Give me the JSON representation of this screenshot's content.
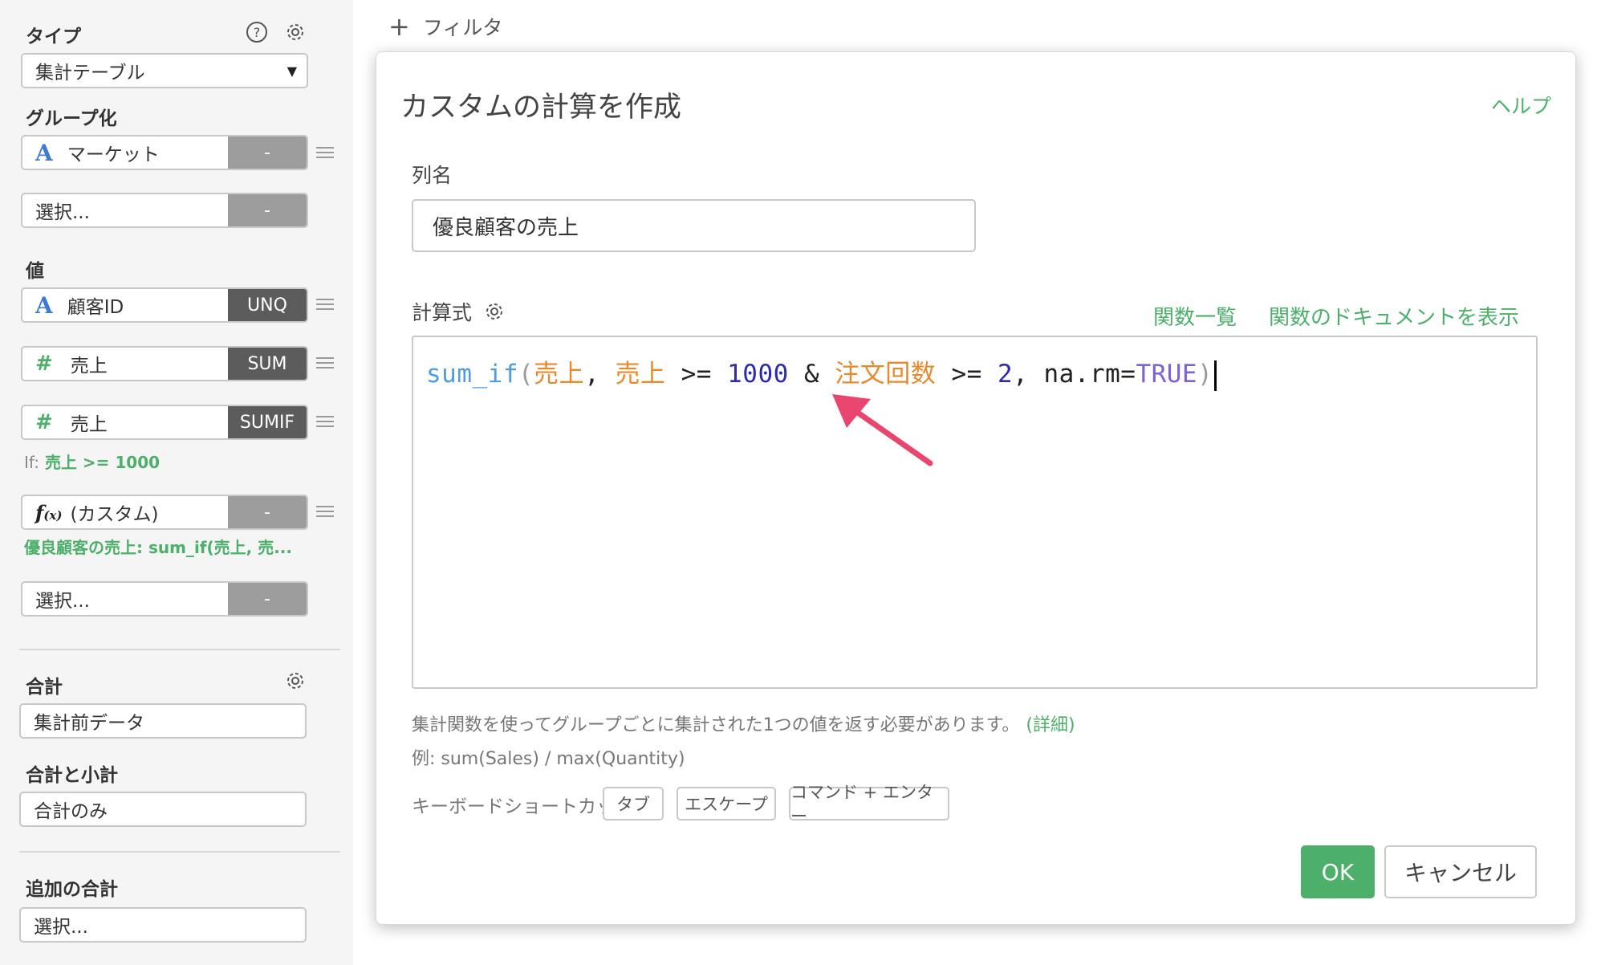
{
  "left": {
    "type_title": "タイプ",
    "type_value": "集計テーブル",
    "group_title": "グループ化",
    "group_items": [
      {
        "name": "マーケット",
        "agg": "-"
      },
      {
        "name": "選択...",
        "agg": "-"
      }
    ],
    "value_title": "値",
    "value_items": [
      {
        "name": "顧客ID",
        "agg": "UNQ"
      },
      {
        "name": "売上",
        "agg": "SUM"
      },
      {
        "name": "売上",
        "agg": "SUMIF"
      },
      {
        "name": "(カスタム)",
        "agg": "-"
      },
      {
        "name": "選択...",
        "agg": "-"
      }
    ],
    "if_prefix": "If:",
    "if_condition": "売上 >= 1000",
    "custom_hint": "優良顧客の売上: sum_if(売上, 売...",
    "total_title": "合計",
    "total_value": "集計前データ",
    "subtotal_title": "合計と小計",
    "subtotal_value": "合計のみ",
    "extra_title": "追加の合計",
    "extra_value": "選択..."
  },
  "filter": {
    "label": "フィルタ"
  },
  "dialog": {
    "title": "カスタムの計算を作成",
    "help": "ヘルプ",
    "column_label": "列名",
    "column_value": "優良顧客の売上",
    "calc_label": "計算式",
    "function_list": "関数一覧",
    "function_docs": "関数のドキュメントを表示",
    "code": {
      "fn": "sum_if",
      "open": "(",
      "arg1": "売上",
      "sep1": ", ",
      "arg2": "売上",
      "op1": " >= ",
      "num1": "1000",
      "amp": " & ",
      "arg3": "注文回数",
      "op2": " >= ",
      "num2": "2",
      "tail": ", na.rm=",
      "kw": "TRUE",
      "close": ")"
    },
    "desc": "集計関数を使ってグループごとに集計された1つの値を返す必要があります。",
    "desc_link": "(詳細)",
    "example": "例: sum(Sales) / max(Quantity)",
    "shortcut_label": "キーボードショートカット:",
    "shortcuts": [
      "タブ",
      "エスケープ",
      "コマンド + エンター"
    ],
    "ok": "OK",
    "cancel": "キャンセル"
  },
  "colors": {
    "accent_green": "#4caf6a",
    "arrow_pink": "#e8466e"
  }
}
